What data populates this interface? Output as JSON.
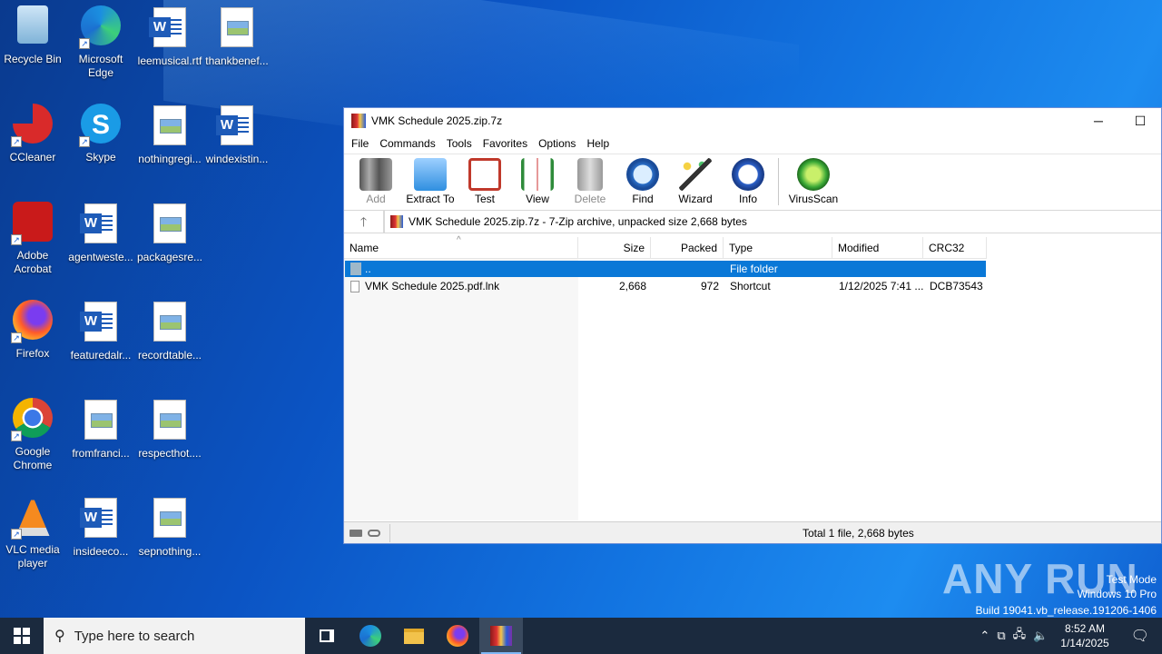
{
  "desktop": {
    "icons": [
      {
        "label": "Recycle Bin",
        "icon": "recycle-bin-icon"
      },
      {
        "label": "Microsoft Edge",
        "icon": "edge-icon"
      },
      {
        "label": "leemusical.rtf",
        "icon": "word-doc-icon"
      },
      {
        "label": "thankbenef...",
        "icon": "image-doc-icon"
      },
      {
        "label": "CCleaner",
        "icon": "ccleaner-icon"
      },
      {
        "label": "Skype",
        "icon": "skype-icon"
      },
      {
        "label": "nothingregi...",
        "icon": "image-doc-icon"
      },
      {
        "label": "windexistin...",
        "icon": "word-doc-icon"
      },
      {
        "label": "Adobe Acrobat",
        "icon": "acrobat-icon"
      },
      {
        "label": "agentweste...",
        "icon": "word-doc-icon"
      },
      {
        "label": "packagesre...",
        "icon": "image-doc-icon"
      },
      {
        "label": "Firefox",
        "icon": "firefox-icon"
      },
      {
        "label": "featuredalr...",
        "icon": "word-doc-icon"
      },
      {
        "label": "recordtable...",
        "icon": "image-doc-icon"
      },
      {
        "label": "Google Chrome",
        "icon": "chrome-icon"
      },
      {
        "label": "fromfranci...",
        "icon": "image-doc-icon"
      },
      {
        "label": "respecthot....",
        "icon": "image-doc-icon"
      },
      {
        "label": "VLC media player",
        "icon": "vlc-icon"
      },
      {
        "label": "insideeco...",
        "icon": "word-doc-icon"
      },
      {
        "label": "sepnothing...",
        "icon": "image-doc-icon"
      }
    ]
  },
  "window": {
    "title": "VMK Schedule 2025.zip.7z",
    "minimize": "─",
    "maximize": "☐",
    "menu": [
      "File",
      "Commands",
      "Tools",
      "Favorites",
      "Options",
      "Help"
    ],
    "toolbar": [
      {
        "label": "Add",
        "icon": "add-archive-icon",
        "disabled": true
      },
      {
        "label": "Extract To",
        "icon": "extract-folder-icon",
        "disabled": false
      },
      {
        "label": "Test",
        "icon": "test-clipboard-icon",
        "disabled": false
      },
      {
        "label": "View",
        "icon": "view-book-icon",
        "disabled": false
      },
      {
        "label": "Delete",
        "icon": "trash-icon",
        "disabled": true
      },
      {
        "label": "Find",
        "icon": "magnifier-icon",
        "disabled": false
      },
      {
        "label": "Wizard",
        "icon": "wand-icon",
        "disabled": false
      },
      {
        "label": "Info",
        "icon": "info-icon",
        "disabled": false
      },
      {
        "label": "VirusScan",
        "icon": "bug-scan-icon",
        "disabled": false
      }
    ],
    "up_arrow": "🡑",
    "address": "VMK Schedule 2025.zip.7z - 7-Zip archive, unpacked size 2,668 bytes",
    "columns": [
      "Name",
      "Size",
      "Packed",
      "Type",
      "Modified",
      "CRC32"
    ],
    "rows": [
      {
        "name": "..",
        "size": "",
        "packed": "",
        "type": "File folder",
        "modified": "",
        "crc": "",
        "selected": true
      },
      {
        "name": "VMK Schedule 2025.pdf.lnk",
        "size": "2,668",
        "packed": "972",
        "type": "Shortcut",
        "modified": "1/12/2025 7:41 ...",
        "crc": "DCB73543",
        "selected": false
      }
    ],
    "status": "Total 1 file, 2,668 bytes"
  },
  "taskbar": {
    "search_placeholder": "Type here to search",
    "time": "8:52 AM",
    "date": "1/14/2025"
  },
  "watermark": {
    "brand": "ANY RUN",
    "line1": "Test Mode",
    "line2": "Windows 10 Pro",
    "line3": "Build 19041.vb_release.191206-1406"
  }
}
